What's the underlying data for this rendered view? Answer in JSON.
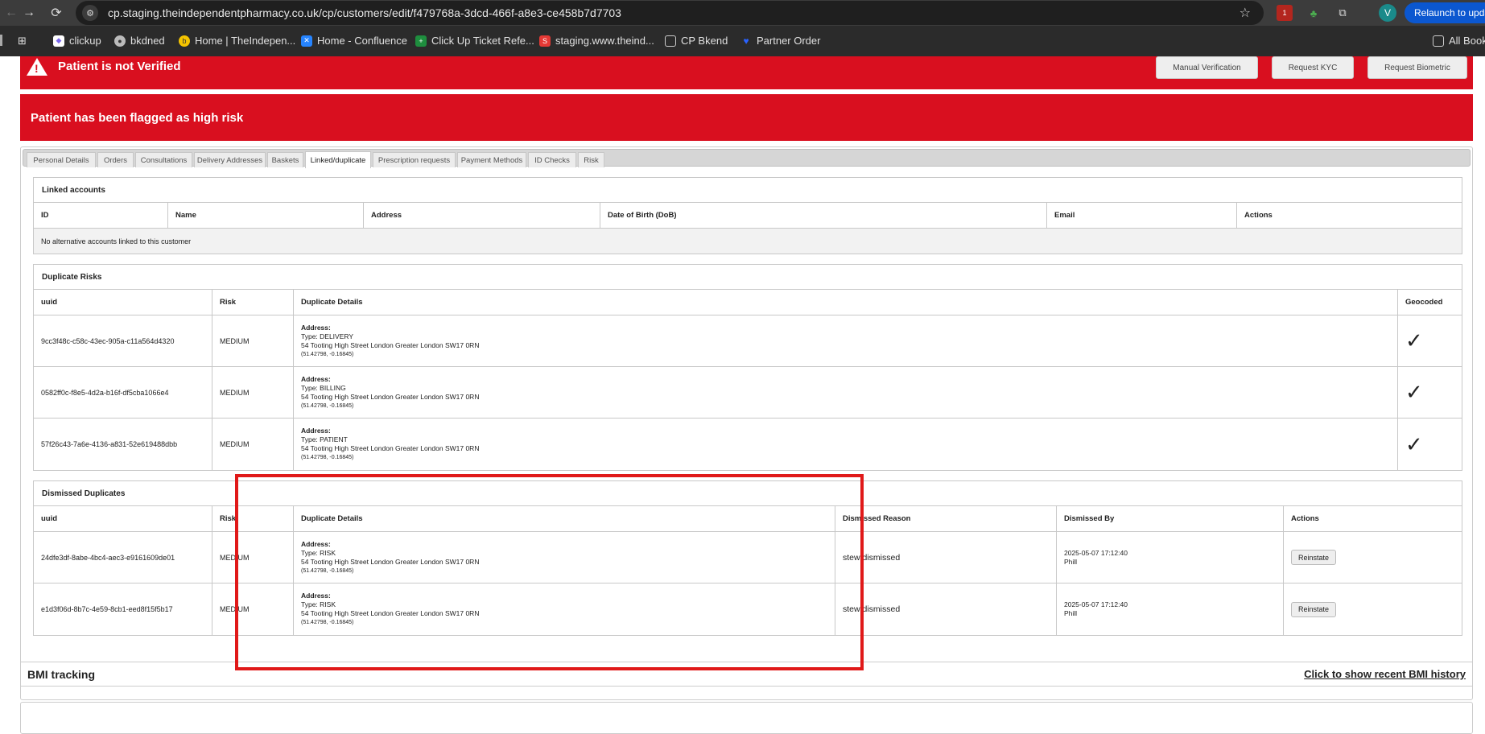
{
  "browser": {
    "url": "cp.staging.theindependentpharmacy.co.uk/cp/customers/edit/f479768a-3dcd-466f-a8e3-ce458b7d7703",
    "avatar_letter": "V",
    "relaunch_label": "Relaunch to upda",
    "extension_badge": "1",
    "bookmarks": [
      "clickup",
      "bkdned",
      "Home | TheIndepen...",
      "Home - Confluence",
      "Click Up Ticket Refe...",
      "staging.www.theind...",
      "CP Bkend",
      "Partner Order"
    ],
    "all_bookmarks": "All Book"
  },
  "alerts": {
    "not_verified": "Patient is not Verified",
    "high_risk": "Patient has been flagged as high risk",
    "buttons": [
      "Manual Verification",
      "Request KYC",
      "Request Biometric"
    ]
  },
  "tabs": [
    "Personal Details",
    "Orders",
    "Consultations",
    "Delivery Addresses",
    "Baskets",
    "Linked/duplicate",
    "Prescription requests",
    "Payment Methods",
    "ID Checks",
    "Risk"
  ],
  "linked": {
    "title": "Linked accounts",
    "columns": [
      "ID",
      "Name",
      "Address",
      "Date of Birth (DoB)",
      "Email",
      "Actions"
    ],
    "empty": "No alternative accounts linked to this customer"
  },
  "duplicates": {
    "title": "Duplicate Risks",
    "columns": [
      "uuid",
      "Risk",
      "Duplicate Details",
      "Geocoded"
    ],
    "rows": [
      {
        "uuid": "9cc3f48c-c58c-43ec-905a-c11a564d4320",
        "risk": "MEDIUM",
        "label": "Address:",
        "type": "Type: DELIVERY",
        "address": "54 Tooting High Street London Greater London SW17 0RN",
        "coords": "(51.42798, -0.16845)",
        "geocoded": "✓"
      },
      {
        "uuid": "0582ff0c-f8e5-4d2a-b16f-df5cba1066e4",
        "risk": "MEDIUM",
        "label": "Address:",
        "type": "Type: BILLING",
        "address": "54 Tooting High Street London Greater London SW17 0RN",
        "coords": "(51.42798, -0.16845)",
        "geocoded": "✓"
      },
      {
        "uuid": "57f26c43-7a6e-4136-a831-52e619488dbb",
        "risk": "MEDIUM",
        "label": "Address:",
        "type": "Type: PATIENT",
        "address": "54 Tooting High Street London Greater London SW17 0RN",
        "coords": "(51.42798, -0.16845)",
        "geocoded": "✓"
      }
    ]
  },
  "dismissed": {
    "title": "Dismissed Duplicates",
    "columns": [
      "uuid",
      "Risk",
      "Duplicate Details",
      "Dismissed Reason",
      "Dismissed By",
      "Actions"
    ],
    "rows": [
      {
        "uuid": "24dfe3df-8abe-4bc4-aec3-e9161609de01",
        "risk": "MEDIUM",
        "label": "Address:",
        "type": "Type: RISK",
        "address": "54 Tooting High Street London Greater London SW17 0RN",
        "coords": "(51.42798, -0.16845)",
        "reason": "stew dismissed",
        "date": "2025-05-07 17:12:40",
        "by": "Phill",
        "action": "Reinstate"
      },
      {
        "uuid": "e1d3f06d-8b7c-4e59-8cb1-eed8f15f5b17",
        "risk": "MEDIUM",
        "label": "Address:",
        "type": "Type: RISK",
        "address": "54 Tooting High Street London Greater London SW17 0RN",
        "coords": "(51.42798, -0.16845)",
        "reason": "stew dismissed",
        "date": "2025-05-07 17:12:40",
        "by": "Phill",
        "action": "Reinstate"
      }
    ]
  },
  "bmi": {
    "title": "BMI tracking",
    "link": "Click to show recent BMI history"
  },
  "colors": {
    "alert_red": "#d90f1f",
    "highlight_red": "#e01919",
    "chrome_dark": "#3c3c3c"
  }
}
